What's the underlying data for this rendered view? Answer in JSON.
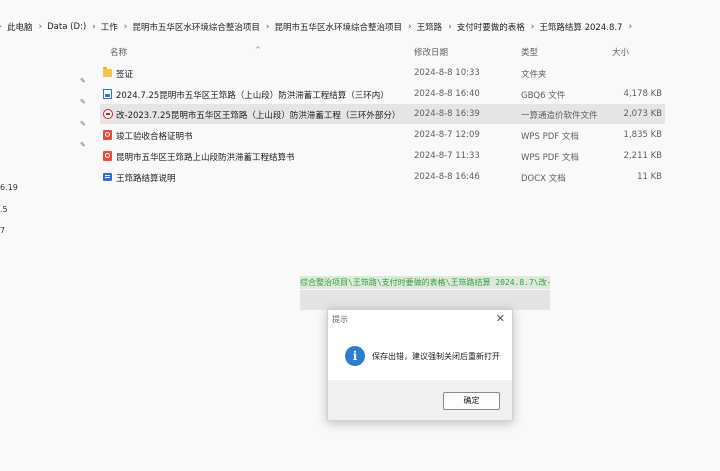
{
  "breadcrumb": [
    "此电脑",
    "Data (D:)",
    "工作",
    "昆明市五华区水环境综合整治项目",
    "昆明市五华区水环境综合整治项目",
    "王筇路",
    "支付时要做的表格",
    "王筇路结算 2024.8.7"
  ],
  "columns": {
    "name": "名称",
    "date": "修改日期",
    "type": "类型",
    "size": "大小"
  },
  "side_labels": [
    "6.19",
    ".5",
    "7"
  ],
  "files": [
    {
      "name": "签证",
      "date": "2024-8-8 10:33",
      "type": "文件夹",
      "size": "",
      "icon": "folder-icon"
    },
    {
      "name": "2024.7.25昆明市五华区王筇路（上山段）防洪滞蓄工程结算（三环内）",
      "date": "2024-8-8 16:40",
      "type": "GBQ6 文件",
      "size": "4,178 KB",
      "icon": "gbq6-file-icon"
    },
    {
      "name": "改-2023.7.25昆明市五华区王筇路（上山段）防洪滞蓄工程（三环外部分）",
      "date": "2024-8-8 16:39",
      "type": "一算通造价软件文件",
      "size": "2,073 KB",
      "icon": "app-file-icon"
    },
    {
      "name": "竣工验收合格证明书",
      "date": "2024-8-7 12:09",
      "type": "WPS PDF 文档",
      "size": "1,835 KB",
      "icon": "pdf-icon"
    },
    {
      "name": "昆明市五华区王筇路上山段防洪滞蓄工程结算书",
      "date": "2024-8-7 11:33",
      "type": "WPS PDF 文档",
      "size": "2,211 KB",
      "icon": "pdf-icon"
    },
    {
      "name": "王筇路结算说明",
      "date": "2024-8-8 16:46",
      "type": "DOCX 文档",
      "size": "11 KB",
      "icon": "docx-icon"
    }
  ],
  "path_strip": "综合整治项目\\王筇路\\支付时要做的表格\\王筇路结算 2024.8.7\\改-202",
  "dialog": {
    "title": "提示",
    "message": "保存出错，建议强制关闭后重新打开",
    "ok_label": "确定"
  }
}
